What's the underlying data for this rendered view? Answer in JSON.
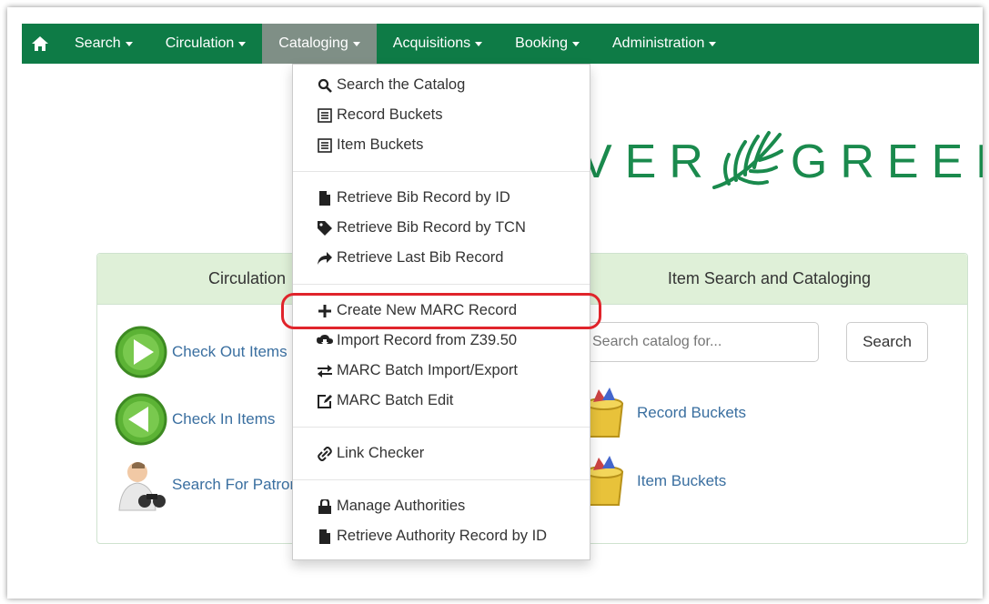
{
  "nav": {
    "items": [
      {
        "label": "Search"
      },
      {
        "label": "Circulation"
      },
      {
        "label": "Cataloging"
      },
      {
        "label": "Acquisitions"
      },
      {
        "label": "Booking"
      },
      {
        "label": "Administration"
      }
    ],
    "active": "Cataloging",
    "color": "#0e7b46"
  },
  "logo": {
    "text": "VER",
    "text2": "GREEN",
    "tm": "™"
  },
  "circulation_panel": {
    "title": "Circulation",
    "items": [
      {
        "label": "Check Out Items"
      },
      {
        "label": "Check In Items"
      },
      {
        "label": "Search For Patrons"
      }
    ]
  },
  "item_panel": {
    "title": "Item Search and Cataloging",
    "search_placeholder": "Search catalog for...",
    "search_button": "Search",
    "links": [
      {
        "label": "Record Buckets"
      },
      {
        "label": "Item Buckets"
      }
    ]
  },
  "dropdown": {
    "groups": [
      [
        {
          "label": "Search the Catalog",
          "icon": "search-icon"
        },
        {
          "label": "Record Buckets",
          "icon": "list-icon"
        },
        {
          "label": "Item Buckets",
          "icon": "list-icon"
        }
      ],
      [
        {
          "label": "Retrieve Bib Record by ID",
          "icon": "file-icon"
        },
        {
          "label": "Retrieve Bib Record by TCN",
          "icon": "tag-icon"
        },
        {
          "label": "Retrieve Last Bib Record",
          "icon": "share-icon"
        }
      ],
      [
        {
          "label": "Create New MARC Record",
          "icon": "plus-icon"
        },
        {
          "label": "Import Record from Z39.50",
          "icon": "cloud-download-icon"
        },
        {
          "label": "MARC Batch Import/Export",
          "icon": "transfer-icon"
        },
        {
          "label": "MARC Batch Edit",
          "icon": "edit-icon"
        }
      ],
      [
        {
          "label": "Link Checker",
          "icon": "link-icon"
        }
      ],
      [
        {
          "label": "Manage Authorities",
          "icon": "lock-icon"
        },
        {
          "label": "Retrieve Authority Record by ID",
          "icon": "file-icon"
        }
      ]
    ],
    "highlighted": "Create New MARC Record",
    "highlight_color": "#e0242b"
  }
}
